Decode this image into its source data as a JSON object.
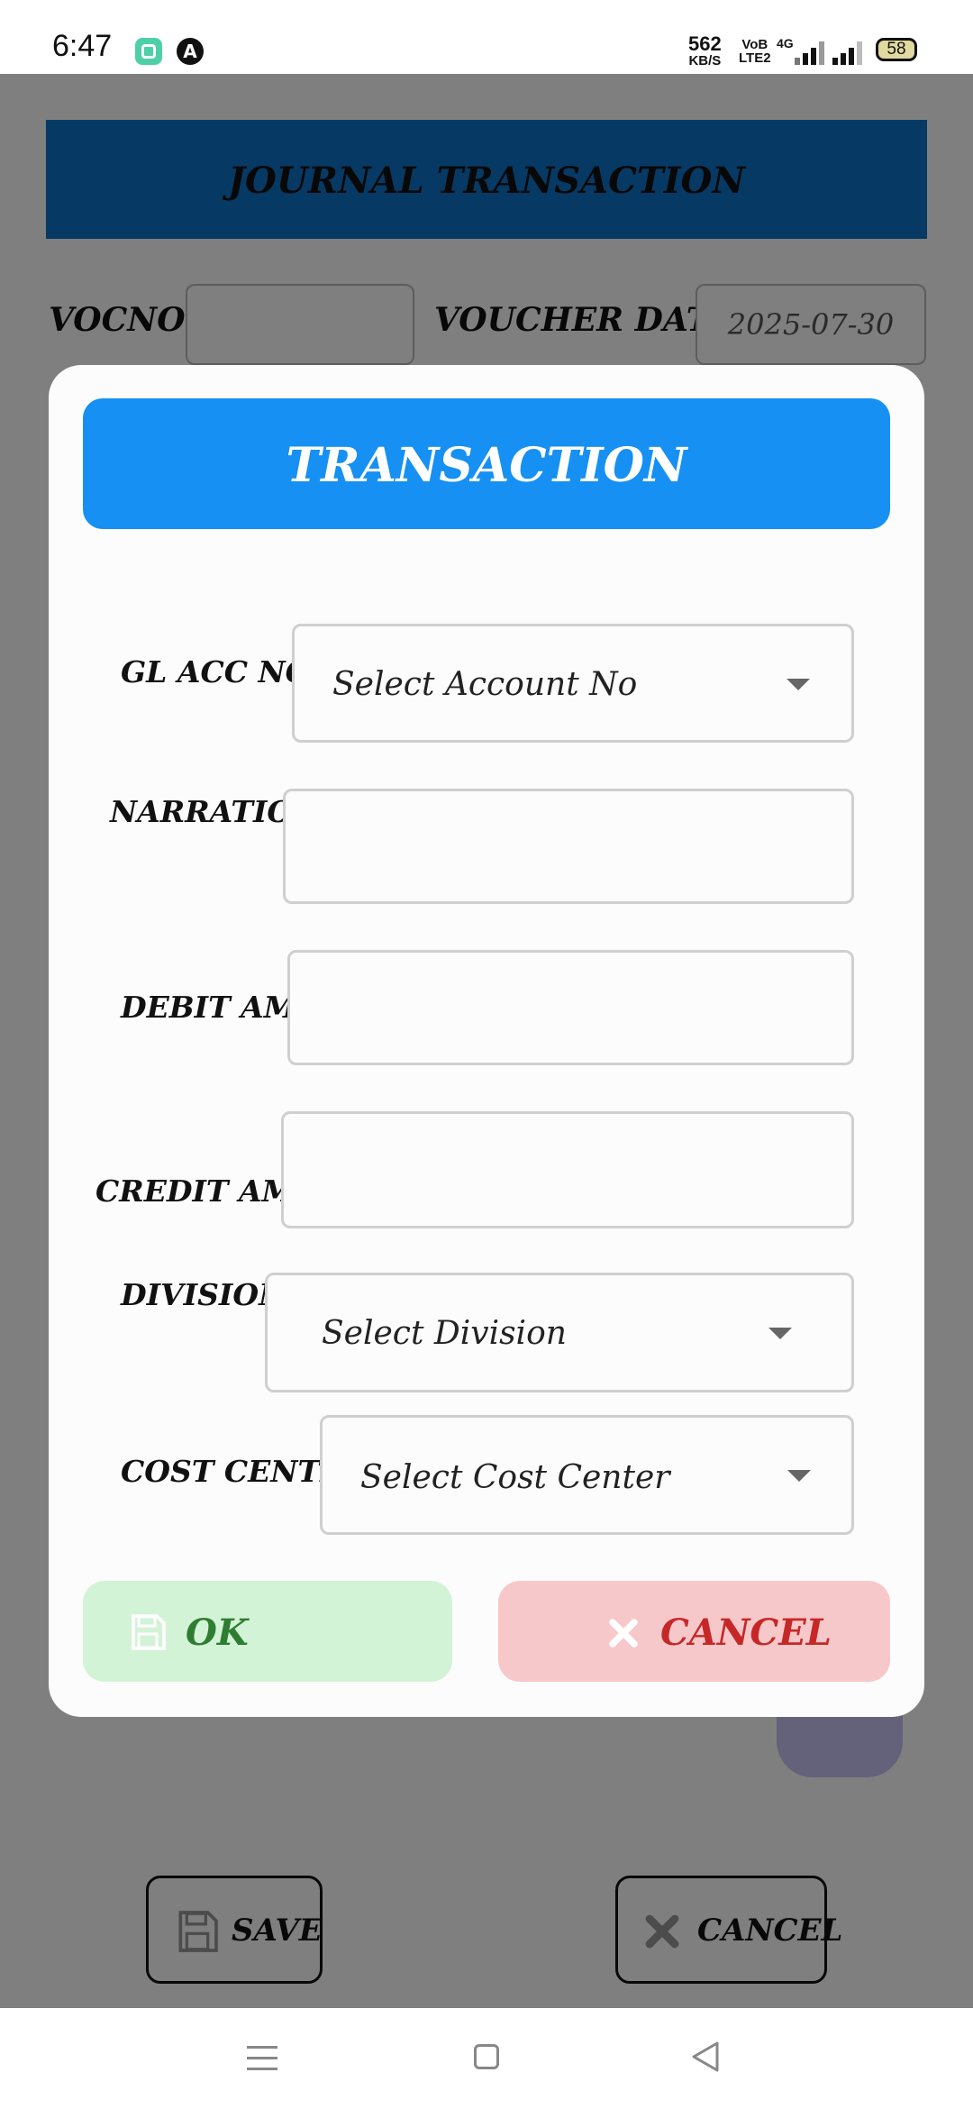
{
  "status_bar": {
    "time": "6:47",
    "net_speed_value": "562",
    "net_speed_unit": "KB/S",
    "volte_line1": "VoB",
    "volte_line2": "LTE2",
    "network": "4G",
    "battery": "58",
    "icons": [
      "app-icon-green",
      "app-icon-dark-a",
      "signal-icon",
      "battery-icon"
    ]
  },
  "background": {
    "header_title": "JOURNAL TRANSACTION",
    "vocno_label": "VOCNO :",
    "vocno_value": "",
    "voucher_date_label": "VOUCHER DATE :",
    "voucher_date_value": "2025-07-30",
    "save_label": "SAVE",
    "cancel_label": "CANCEL"
  },
  "dialog": {
    "title": "TRANSACTION",
    "gl_acc_label": "GL ACC NO :",
    "gl_acc_placeholder": "Select Account No",
    "narration_label": "NARRATION :",
    "narration_value": "",
    "debit_label": "DEBIT AMT :",
    "debit_value": "",
    "credit_label": "CREDIT AMT :",
    "credit_value": "",
    "division_label": "DIVISION :",
    "division_placeholder": "Select Division",
    "cost_center_label": "COST CENTER :",
    "cost_center_placeholder": "Select Cost Center",
    "ok_label": "OK",
    "cancel_label": "CANCEL"
  },
  "colors": {
    "header_bg": "#0d73c6",
    "dialog_header_bg": "#1690f2",
    "ok_bg": "#d3f3d7",
    "ok_text": "#2e7d32",
    "cancel_bg": "#f7c8ca",
    "cancel_text": "#c62828"
  },
  "nav_icons": [
    "menu-icon",
    "home-icon",
    "back-icon"
  ]
}
